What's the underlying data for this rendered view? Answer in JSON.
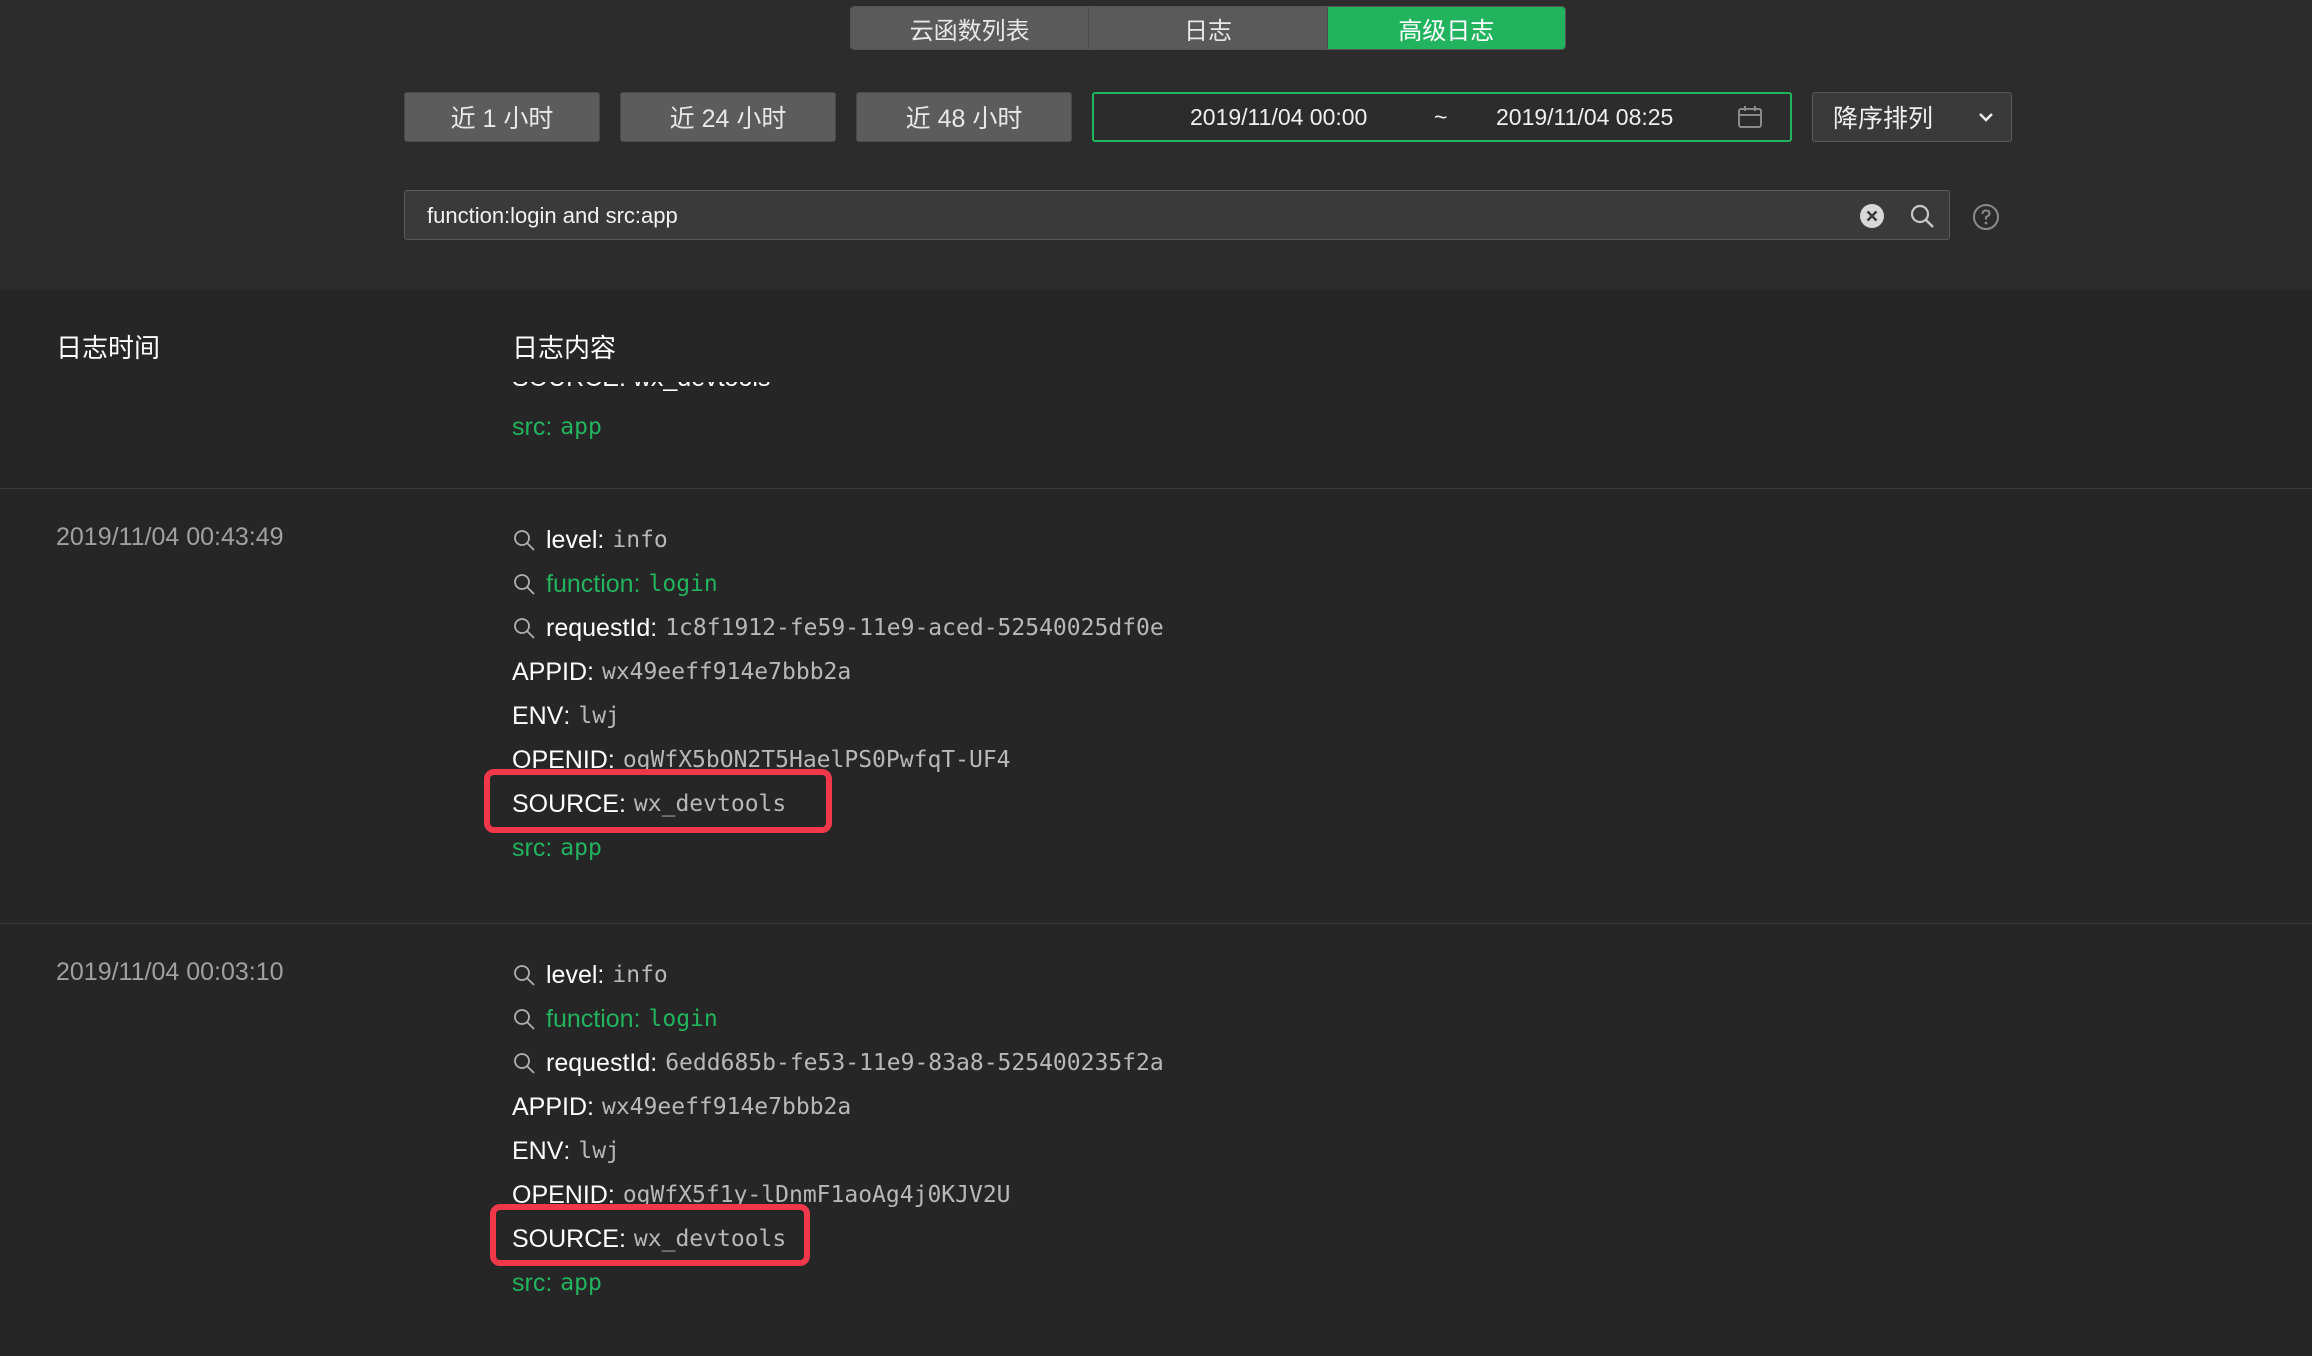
{
  "tabs": [
    {
      "label": "云函数列表",
      "active": false
    },
    {
      "label": "日志",
      "active": false
    },
    {
      "label": "高级日志",
      "active": true
    }
  ],
  "quick_ranges": [
    "近 1 小时",
    "近 24 小时",
    "近 48 小时"
  ],
  "date_range": {
    "start": "2019/11/04 00:00",
    "separator": "~",
    "end": "2019/11/04 08:25"
  },
  "sort": {
    "label": "降序排列"
  },
  "search": {
    "value": "function:login and src:app"
  },
  "table": {
    "col_time": "日志时间",
    "col_content": "日志内容"
  },
  "partial_entry": {
    "source_line": "SOURCE: wx_devtools",
    "src_key": "src",
    "src_val": "app"
  },
  "entries": [
    {
      "time": "2019/11/04 00:43:49",
      "fields": [
        {
          "key": "level",
          "value": "info"
        },
        {
          "key": "function",
          "value": "login"
        },
        {
          "key": "requestId",
          "value": "1c8f1912-fe59-11e9-aced-52540025df0e"
        },
        {
          "key": "APPID",
          "value": "wx49eeff914e7bbb2a"
        },
        {
          "key": "ENV",
          "value": "lwj"
        },
        {
          "key": "OPENID",
          "value": "ogWfX5bON2T5HaelPS0PwfqT-UF4"
        },
        {
          "key": "SOURCE",
          "value": "wx_devtools"
        },
        {
          "key": "src",
          "value": "app"
        }
      ]
    },
    {
      "time": "2019/11/04 00:03:10",
      "fields": [
        {
          "key": "level",
          "value": "info"
        },
        {
          "key": "function",
          "value": "login"
        },
        {
          "key": "requestId",
          "value": "6edd685b-fe53-11e9-83a8-525400235f2a"
        },
        {
          "key": "APPID",
          "value": "wx49eeff914e7bbb2a"
        },
        {
          "key": "ENV",
          "value": "lwj"
        },
        {
          "key": "OPENID",
          "value": "ogWfX5f1y-lDnmF1aoAg4j0KJV2U"
        },
        {
          "key": "SOURCE",
          "value": "wx_devtools"
        },
        {
          "key": "src",
          "value": "app"
        }
      ]
    }
  ],
  "colors": {
    "accent": "#22b35e",
    "highlight": "#f0384a",
    "background": "#262626"
  }
}
